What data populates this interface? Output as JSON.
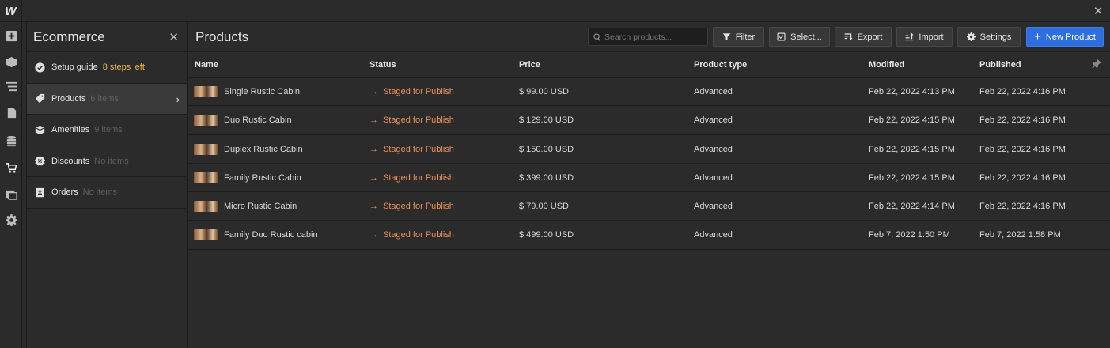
{
  "app": {
    "logo": "W",
    "close": "✕"
  },
  "panel": {
    "title": "Ecommerce",
    "close": "✕",
    "items": [
      {
        "label": "Setup guide",
        "count": "8 steps left",
        "icon": "check-circle-icon"
      },
      {
        "label": "Products",
        "count": "6 items",
        "icon": "tag-icon"
      },
      {
        "label": "Amenities",
        "count": "9 items",
        "icon": "box-icon"
      },
      {
        "label": "Discounts",
        "count": "No items",
        "icon": "badge-icon"
      },
      {
        "label": "Orders",
        "count": "No items",
        "icon": "receipt-icon"
      }
    ]
  },
  "main": {
    "title": "Products",
    "search_placeholder": "Search products...",
    "buttons": {
      "filter": "Filter",
      "select": "Select...",
      "export": "Export",
      "import": "Import",
      "settings": "Settings",
      "new_product": "New Product"
    },
    "columns": [
      "Name",
      "Status",
      "Price",
      "Product type",
      "Modified",
      "Published"
    ],
    "rows": [
      {
        "name": "Single Rustic Cabin",
        "status": "Staged for Publish",
        "price": "$ 99.00 USD",
        "type": "Advanced",
        "modified": "Feb 22, 2022 4:13 PM",
        "published": "Feb 22, 2022 4:16 PM"
      },
      {
        "name": "Duo Rustic Cabin",
        "status": "Staged for Publish",
        "price": "$ 129.00 USD",
        "type": "Advanced",
        "modified": "Feb 22, 2022 4:15 PM",
        "published": "Feb 22, 2022 4:16 PM"
      },
      {
        "name": "Duplex Rustic Cabin",
        "status": "Staged for Publish",
        "price": "$ 150.00 USD",
        "type": "Advanced",
        "modified": "Feb 22, 2022 4:15 PM",
        "published": "Feb 22, 2022 4:16 PM"
      },
      {
        "name": "Family Rustic Cabin",
        "status": "Staged for Publish",
        "price": "$ 399.00 USD",
        "type": "Advanced",
        "modified": "Feb 22, 2022 4:15 PM",
        "published": "Feb 22, 2022 4:16 PM"
      },
      {
        "name": "Micro Rustic Cabin",
        "status": "Staged for Publish",
        "price": "$ 79.00 USD",
        "type": "Advanced",
        "modified": "Feb 22, 2022 4:14 PM",
        "published": "Feb 22, 2022 4:16 PM"
      },
      {
        "name": "Family Duo Rustic cabin",
        "status": "Staged for Publish",
        "price": "$ 499.00 USD",
        "type": "Advanced",
        "modified": "Feb 7, 2022 1:50 PM",
        "published": "Feb 7, 2022 1:58 PM"
      }
    ]
  },
  "colors": {
    "accent": "#2d6fe0",
    "status": "#e9915a",
    "warning": "#e8b84a"
  }
}
